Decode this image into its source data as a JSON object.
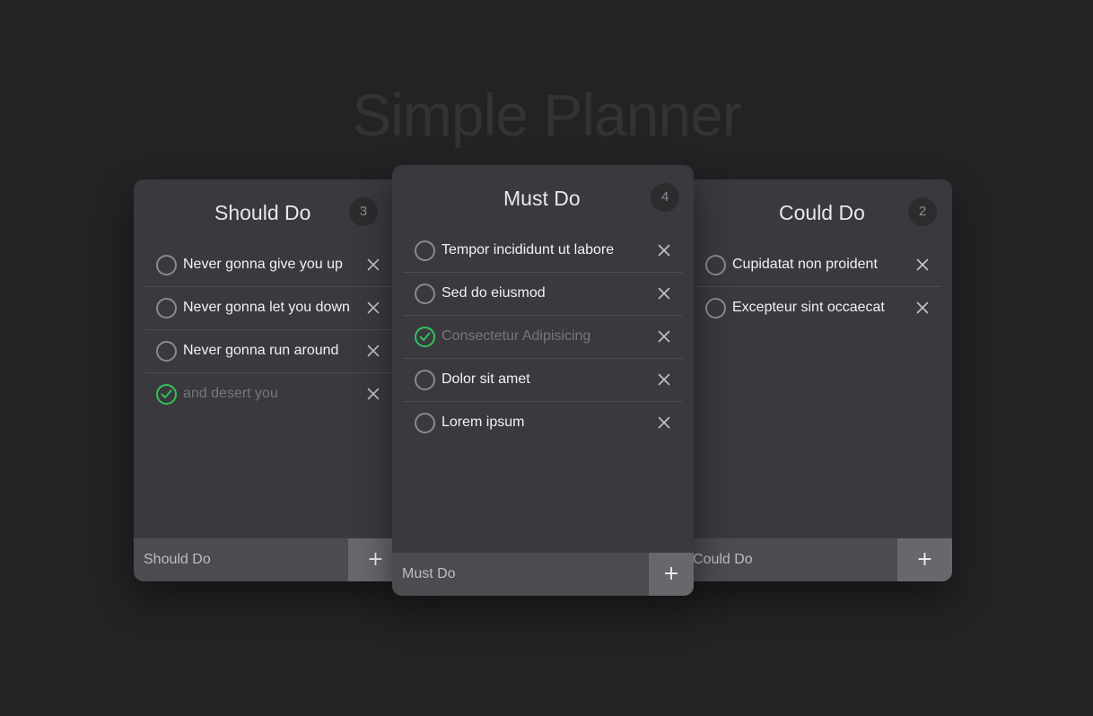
{
  "app": {
    "title": "Simple Planner"
  },
  "colors": {
    "background": "#232325",
    "board": "#3a3a3e",
    "done": "#32c25a"
  },
  "boards": {
    "should": {
      "title": "Should Do",
      "count": "3",
      "placeholder": "Should Do",
      "add_label": "+",
      "tasks": [
        {
          "text": "Never gonna give you up",
          "done": false
        },
        {
          "text": "Never gonna let you down",
          "done": false
        },
        {
          "text": "Never gonna run around",
          "done": false
        },
        {
          "text": "and desert you",
          "done": true
        }
      ]
    },
    "must": {
      "title": "Must Do",
      "count": "4",
      "placeholder": "Must Do",
      "add_label": "+",
      "tasks": [
        {
          "text": "Tempor incididunt ut labore",
          "done": false
        },
        {
          "text": "Sed do eiusmod",
          "done": false
        },
        {
          "text": "Consectetur Adipisicing",
          "done": true
        },
        {
          "text": "Dolor sit amet",
          "done": false
        },
        {
          "text": "Lorem ipsum",
          "done": false
        }
      ]
    },
    "could": {
      "title": "Could Do",
      "count": "2",
      "placeholder": "Could Do",
      "add_label": "+",
      "tasks": [
        {
          "text": "Cupidatat non proident",
          "done": false
        },
        {
          "text": "Excepteur sint occaecat",
          "done": false
        }
      ]
    }
  }
}
